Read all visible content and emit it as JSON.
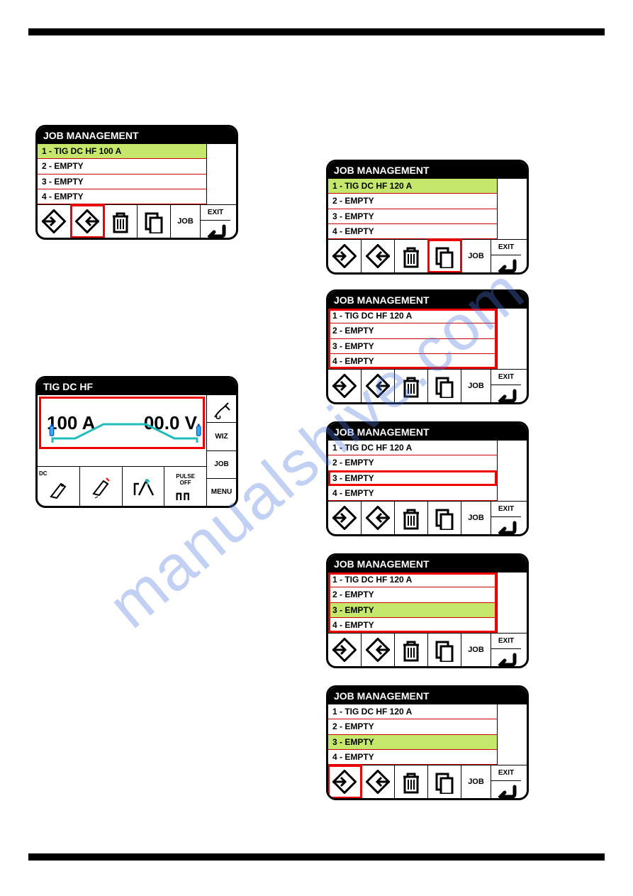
{
  "watermark": "manualshive.com",
  "panel_left1": {
    "title": "JOB MANAGEMENT",
    "rows": [
      "1 - TIG DC HF 100 A",
      "2 - EMPTY",
      "3 - EMPTY",
      "4 - EMPTY"
    ],
    "selected": 0,
    "exit": "EXIT",
    "job": "JOB"
  },
  "tig": {
    "title": "TIG DC HF",
    "amps": "100 A",
    "volts": "00.0 V",
    "side": [
      "WIZ",
      "JOB",
      "MENU"
    ],
    "bottom_dc": "DC",
    "bottom_pulse_top": "PULSE",
    "bottom_pulse_bot": "OFF"
  },
  "panel_r1": {
    "title": "JOB MANAGEMENT",
    "rows": [
      "1 - TIG DC HF 120 A",
      "2 - EMPTY",
      "3 - EMPTY",
      "4 - EMPTY"
    ],
    "selected": 0,
    "exit": "EXIT",
    "job": "JOB"
  },
  "panel_r2": {
    "title": "JOB MANAGEMENT",
    "rows": [
      "1 - TIG DC HF 120 A",
      "2 - EMPTY",
      "3 - EMPTY",
      "4 - EMPTY"
    ],
    "selected": -1,
    "exit": "EXIT",
    "job": "JOB"
  },
  "panel_r3": {
    "title": "JOB MANAGEMENT",
    "rows": [
      "1 - TIG DC HF 120 A",
      "2 - EMPTY",
      "3 - EMPTY",
      "4 - EMPTY"
    ],
    "selected": -1,
    "exit": "EXIT",
    "job": "JOB"
  },
  "panel_r4": {
    "title": "JOB MANAGEMENT",
    "rows": [
      "1 - TIG DC HF 120 A",
      "2 - EMPTY",
      "3 - EMPTY",
      "4 - EMPTY"
    ],
    "selected": 2,
    "exit": "EXIT",
    "job": "JOB"
  },
  "panel_r5": {
    "title": "JOB MANAGEMENT",
    "rows": [
      "1 - TIG DC HF 120 A",
      "2 - EMPTY",
      "3 - EMPTY",
      "4 - EMPTY"
    ],
    "selected": 2,
    "exit": "EXIT",
    "job": "JOB"
  }
}
